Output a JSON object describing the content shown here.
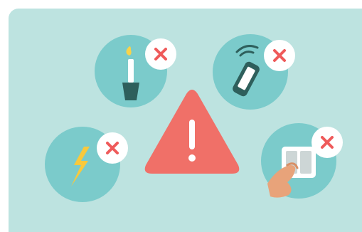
{
  "illustration": {
    "colors": {
      "background_panel": "#bde3e0",
      "icon_circle": "#7bcbcb",
      "badge_bg": "#ffffff",
      "badge_cross": "#ef5a5a",
      "warning_triangle": "#f07068",
      "warning_mark": "#ffffff",
      "candle_holder": "#2e5f5c",
      "candle_flame": "#f9d34a",
      "phone_body": "#2e5f5c",
      "lightning": "#f9c93c",
      "switch_plate": "#ffffff",
      "switch_key": "#cdd6d6",
      "hand_skin": "#e8a37a"
    },
    "items": [
      {
        "icon": "candle-icon",
        "status": "not-allowed",
        "status_icon": "close-icon"
      },
      {
        "icon": "mobile-phone-icon",
        "status": "not-allowed",
        "status_icon": "close-icon"
      },
      {
        "icon": "lightning-bolt-icon",
        "status": "not-allowed",
        "status_icon": "close-icon"
      },
      {
        "icon": "light-switch-icon",
        "status": "not-allowed",
        "status_icon": "close-icon"
      }
    ],
    "center_icon": "warning-triangle-icon"
  }
}
